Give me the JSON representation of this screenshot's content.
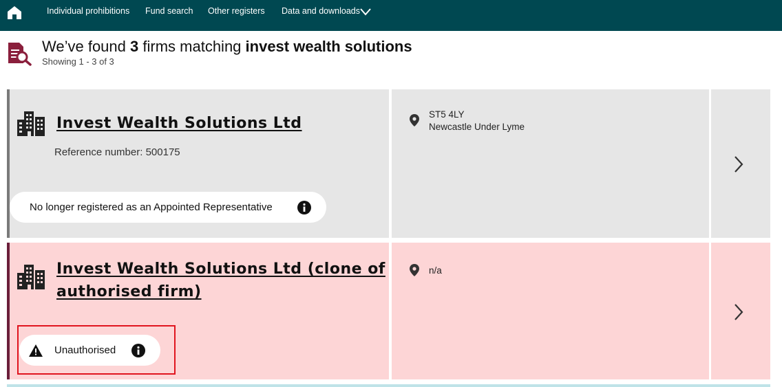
{
  "nav": {
    "home_icon": "home-icon",
    "links": [
      "Individual prohibitions",
      "Fund search",
      "Other registers",
      "Data and downloads"
    ],
    "dropdown_icon": "chevron-down-icon"
  },
  "search": {
    "icon": "document-search-icon",
    "headline_prefix": "We’ve found ",
    "count": "3",
    "headline_middle": " firms matching ",
    "query": "invest wealth solutions",
    "showing": "Showing 1 - 3 of 3"
  },
  "results": [
    {
      "name": "Invest Wealth Solutions Ltd",
      "reference": "Reference number: 500175",
      "status": "No longer registered as an Appointed Representative",
      "postcode": "ST5 4LY",
      "town": "Newcastle Under Lyme",
      "bg_color": "#e6e6e6",
      "bar_color": "#7a7a7a"
    },
    {
      "name_line1": "Invest Wealth Solutions Ltd (clone of",
      "name_line2": "authorised firm)",
      "status": "Unauthorised",
      "address": "n/a",
      "bg_color": "#fdd5d6",
      "bar_color": "#6b1f3a"
    }
  ],
  "colors": {
    "nav_bg": "#004851",
    "highlight_border": "#e0141e",
    "icon_maroon": "#8a1f3c"
  }
}
